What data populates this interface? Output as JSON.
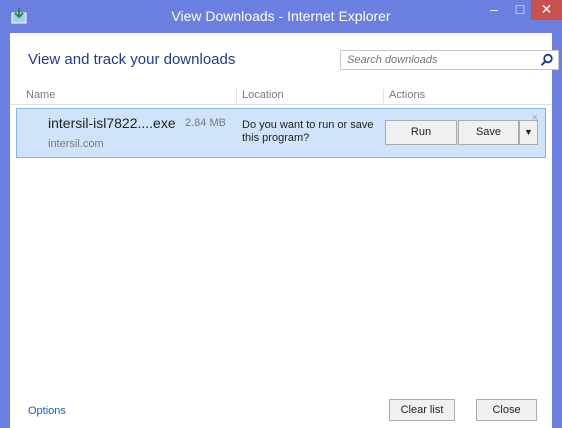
{
  "window": {
    "title": "View Downloads - Internet Explorer",
    "controls": {
      "minimize": "–",
      "maximize": "□",
      "close": "✕"
    }
  },
  "header": {
    "title": "View and track your downloads",
    "search_placeholder": "Search downloads"
  },
  "columns": {
    "name": "Name",
    "location": "Location",
    "actions": "Actions"
  },
  "downloads": [
    {
      "file_name": "intersil-isl7822....exe",
      "size": "2.84 MB",
      "domain": "intersil.com",
      "prompt": "Do you want to run or save this program?",
      "run_label": "Run",
      "save_label": "Save",
      "dropdown_arrow": "▼",
      "dismiss": "×"
    }
  ],
  "footer": {
    "options": "Options",
    "clear_list": "Clear list",
    "close": "Close"
  },
  "colors": {
    "accent": "#6b7fe0",
    "close_button": "#c7514f",
    "selected_row": "#cfe4fb",
    "heading": "#1e3b8f"
  }
}
